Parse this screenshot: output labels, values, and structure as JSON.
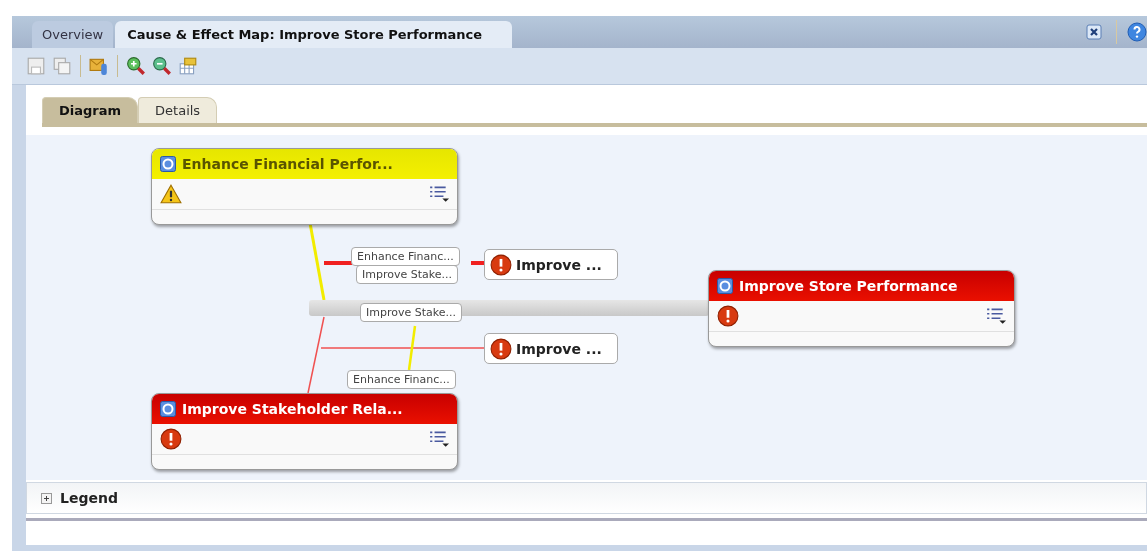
{
  "tabs": [
    {
      "label": "Overview",
      "selected": false
    },
    {
      "label": "Cause & Effect Map: Improve Store Performance",
      "selected": true
    }
  ],
  "view_tabs": [
    {
      "label": "Diagram",
      "selected": true
    },
    {
      "label": "Details",
      "selected": false
    }
  ],
  "objectives": [
    {
      "title": "Enhance Financial Perfor...",
      "warning": true
    },
    {
      "title": "Improve Store Performance",
      "warning": false
    },
    {
      "title": "Improve Stakeholder Rela...",
      "warning": false
    }
  ],
  "mini_nodes": [
    {
      "title": "Improve ...",
      "warning": false
    },
    {
      "title": "Improve ...",
      "warning": false
    }
  ],
  "link_labels": [
    "Enhance Financ...",
    "Improve Stake...",
    "Improve Stake...",
    "Enhance Financ..."
  ],
  "legend": {
    "title": "Legend",
    "expanded": false
  }
}
